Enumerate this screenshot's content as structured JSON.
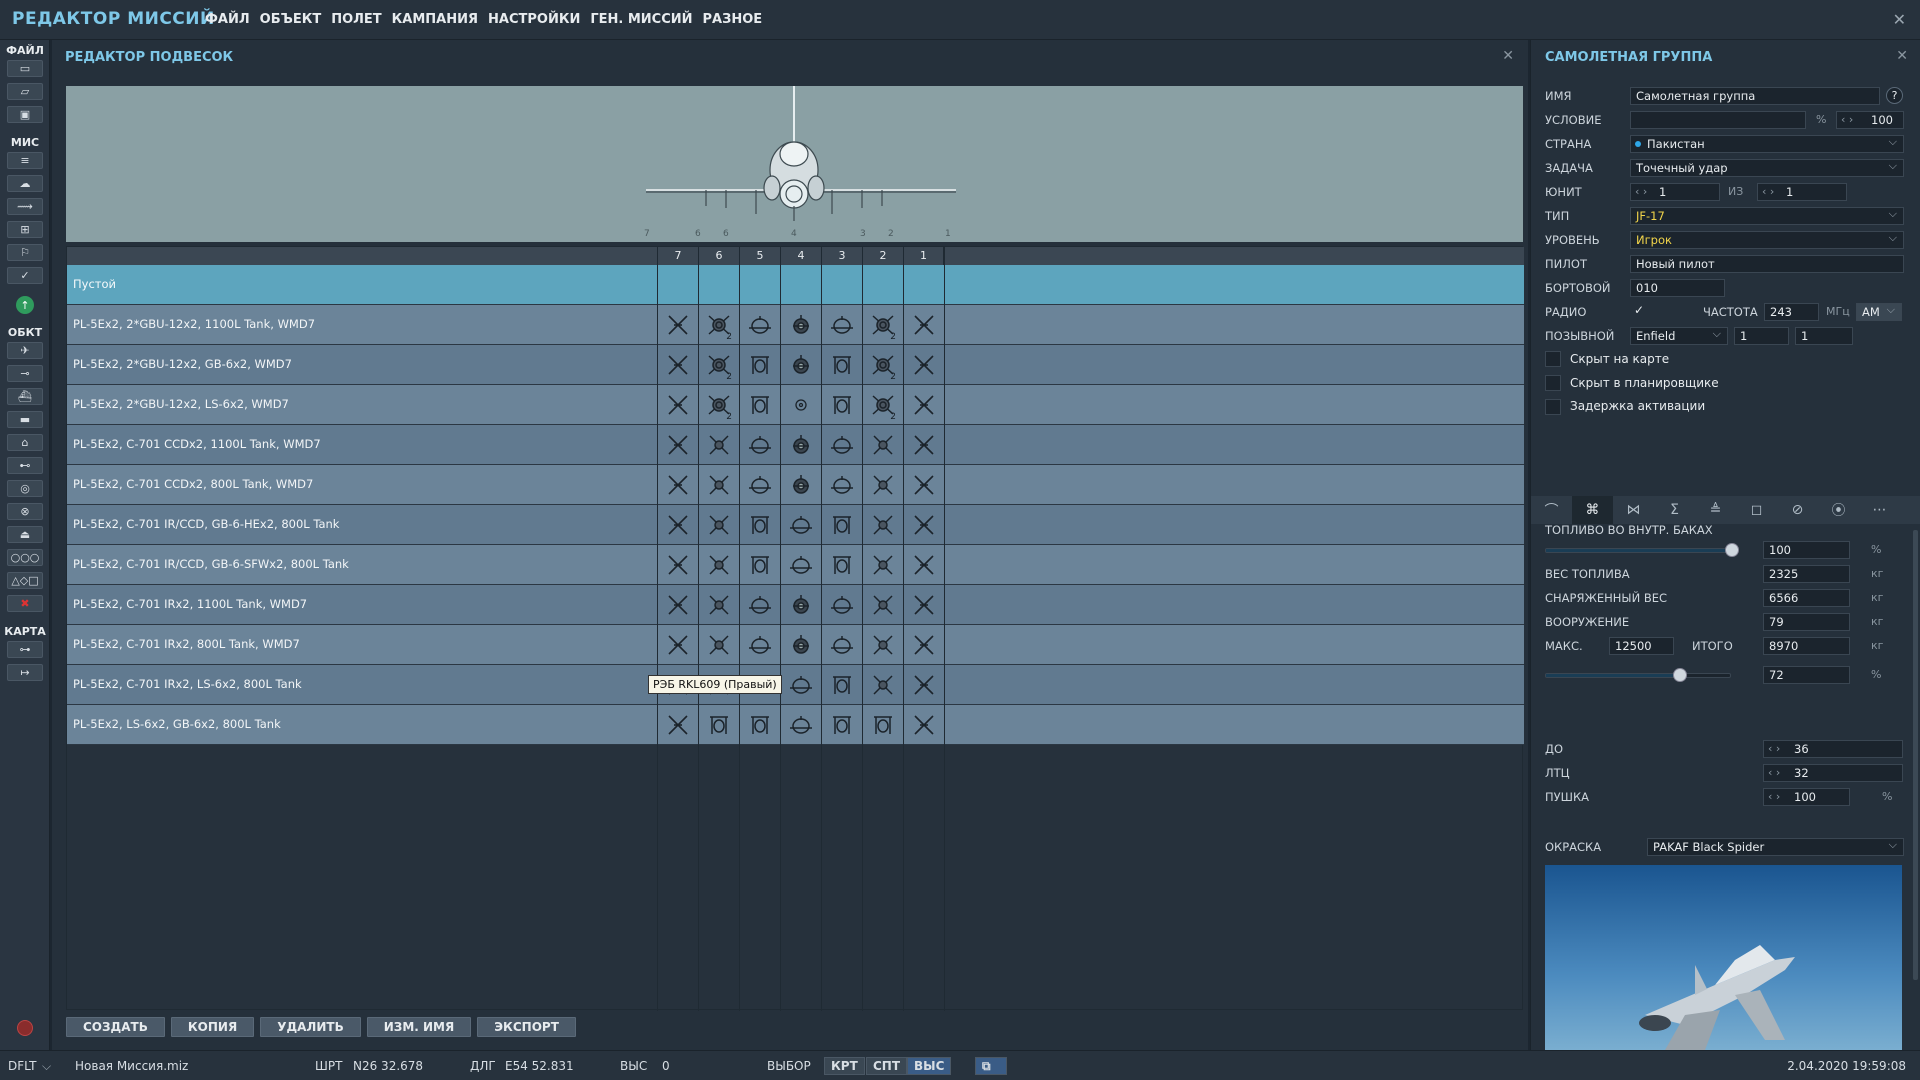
{
  "app_title": "РЕДАКТОР МИССИЙ",
  "menu": [
    "ФАЙЛ",
    "ОБЪЕКТ",
    "ПОЛЕТ",
    "КАМПАНИЯ",
    "НАСТРОЙКИ",
    "ГЕН. МИССИЙ",
    "РАЗНОЕ"
  ],
  "left_toolbar": {
    "file_label": "ФАЙЛ",
    "mis_label": "МИС",
    "obj_label": "ОБКТ",
    "map_label": "КАРТА"
  },
  "loadout": {
    "title": "РЕДАКТОР ПОДВЕСОК",
    "stations": [
      "7",
      "6",
      "5",
      "4",
      "3",
      "2",
      "1"
    ],
    "preview_station_labels": [
      "7",
      "6",
      "5",
      "4",
      "3",
      "2",
      "1"
    ],
    "rows": [
      {
        "name": "Пустой",
        "selected": true,
        "cells": [
          "",
          "",
          "",
          "",
          "",
          "",
          ""
        ]
      },
      {
        "name": "PL-5Ex2, 2*GBU-12x2, 1100L Tank, WMD7",
        "cells": [
          "x",
          "b2",
          "t",
          "p",
          "t",
          "b2",
          "x"
        ]
      },
      {
        "name": "PL-5Ex2, 2*GBU-12x2, GB-6x2, WMD7",
        "cells": [
          "x",
          "b2",
          "r",
          "p",
          "r",
          "b2",
          "x"
        ]
      },
      {
        "name": "PL-5Ex2, 2*GBU-12x2, LS-6x2, WMD7",
        "cells": [
          "x",
          "b2",
          "r",
          "o",
          "r",
          "b2",
          "x"
        ]
      },
      {
        "name": "PL-5Ex2, C-701 CCDx2, 1100L Tank, WMD7",
        "cells": [
          "x",
          "m",
          "t",
          "p",
          "t",
          "m",
          "x"
        ]
      },
      {
        "name": "PL-5Ex2, C-701 CCDx2, 800L Tank, WMD7",
        "cells": [
          "x",
          "m",
          "t",
          "p",
          "t",
          "m",
          "x"
        ]
      },
      {
        "name": "PL-5Ex2, C-701 IR/CCD, GB-6-HEx2, 800L Tank",
        "cells": [
          "x",
          "m",
          "r",
          "t",
          "r",
          "m",
          "x"
        ]
      },
      {
        "name": "PL-5Ex2, C-701 IR/CCD, GB-6-SFWx2, 800L Tank",
        "cells": [
          "x",
          "m",
          "r",
          "t",
          "r",
          "m",
          "x"
        ]
      },
      {
        "name": "PL-5Ex2, C-701 IRx2, 1100L Tank, WMD7",
        "cells": [
          "x",
          "m",
          "t",
          "p",
          "t",
          "m",
          "x"
        ]
      },
      {
        "name": "PL-5Ex2, C-701 IRx2, 800L Tank, WMD7",
        "cells": [
          "x",
          "m",
          "t",
          "p",
          "t",
          "m",
          "x"
        ]
      },
      {
        "name": "PL-5Ex2, C-701 IRx2, LS-6x2, 800L Tank",
        "cells": [
          "x",
          "m",
          "r",
          "t",
          "r",
          "m",
          "x"
        ]
      },
      {
        "name": "PL-5Ex2, LS-6x2, GB-6x2, 800L Tank",
        "cells": [
          "x",
          "r",
          "r",
          "t",
          "r",
          "r",
          "x"
        ]
      }
    ],
    "tooltip": "РЭБ RKL609 (Правый)",
    "buttons": {
      "create": "СОЗДАТЬ",
      "copy": "КОПИЯ",
      "delete": "УДАЛИТЬ",
      "rename": "ИЗМ. ИМЯ",
      "export": "ЭКСПОРТ"
    }
  },
  "group": {
    "title": "САМОЛЕТНАЯ ГРУППА",
    "help": "?",
    "name_label": "ИМЯ",
    "name_value": "Самолетная группа",
    "condition_label": "УСЛОВИЕ",
    "condition_value": "",
    "percent": "%",
    "condition_chance": "100",
    "country_label": "СТРАНА",
    "country_value": "Пакистан",
    "task_label": "ЗАДАЧА",
    "task_value": "Точечный удар",
    "unit_label": "ЮНИТ",
    "unit_value": "1",
    "of_label": "ИЗ",
    "of_value": "1",
    "type_label": "ТИП",
    "type_value": "JF-17",
    "level_label": "УРОВЕНЬ",
    "level_value": "Игрок",
    "pilot_label": "ПИЛОТ",
    "pilot_value": "Новый пилот",
    "tail_label": "БОРТОВОЙ",
    "tail_value": "010",
    "radio_label": "РАДИО",
    "radio_checked": true,
    "freq_label": "ЧАСТОТА",
    "freq_value": "243",
    "freq_unit": "МГц",
    "modulation": "AM",
    "callsign_label": "ПОЗЫВНОЙ",
    "callsign_value": "Enfield",
    "callsign_n1": "1",
    "callsign_n2": "1",
    "hidden_map": "Скрыт на карте",
    "hidden_planner": "Скрыт в планировщике",
    "late_activation": "Задержка активации",
    "tabs": [
      "route-icon",
      "payload-icon",
      "targets-icon",
      "summary-icon",
      "waypoints-icon",
      "square-icon",
      "no-entry-icon",
      "radio-icon",
      "more-icon"
    ],
    "payload": {
      "fuel_internal_label": "ТОПЛИВО ВО ВНУТР. БАКАХ",
      "fuel_internal_value": "100",
      "fuel_internal_level": 100,
      "fuel_weight_label": "ВЕС ТОПЛИВА",
      "fuel_weight_value": "2325",
      "empty_weight_label": "СНАРЯЖЕННЫЙ ВЕС",
      "empty_weight_value": "6566",
      "weapons_label": "ВООРУЖЕНИЕ",
      "weapons_value": "79",
      "max_label": "МАКС.",
      "max_value": "12500",
      "total_label": "ИТОГО",
      "total_value": "8970",
      "load_percent_value": "72",
      "load_percent_level": 72,
      "kg": "кг",
      "pct": "%",
      "chaff_label": "ДО",
      "chaff_value": "36",
      "flare_label": "ЛТЦ",
      "flare_value": "32",
      "gun_label": "ПУШКА",
      "gun_value": "100"
    },
    "livery_label": "ОКРАСКА",
    "livery_value": "PAKAF Black Spider"
  },
  "statusbar": {
    "mode": "DFLT",
    "mission": "Новая Миссия.miz",
    "lat_label": "ШРТ",
    "lat_value": "N26 32.678",
    "lon_label": "ДЛГ",
    "lon_value": "E54 52.831",
    "alt_label": "ВЫС",
    "alt_value": "0",
    "select_label": "ВЫБОР",
    "b1": "КРТ",
    "b2": "СПТ",
    "b3": "ВЫС",
    "datetime": "2.04.2020 19:59:08"
  },
  "colors": {
    "accent": "#7ec8e8",
    "selected_row": "#5da5be",
    "row_a": "#6b8499",
    "row_b": "#617a90"
  }
}
